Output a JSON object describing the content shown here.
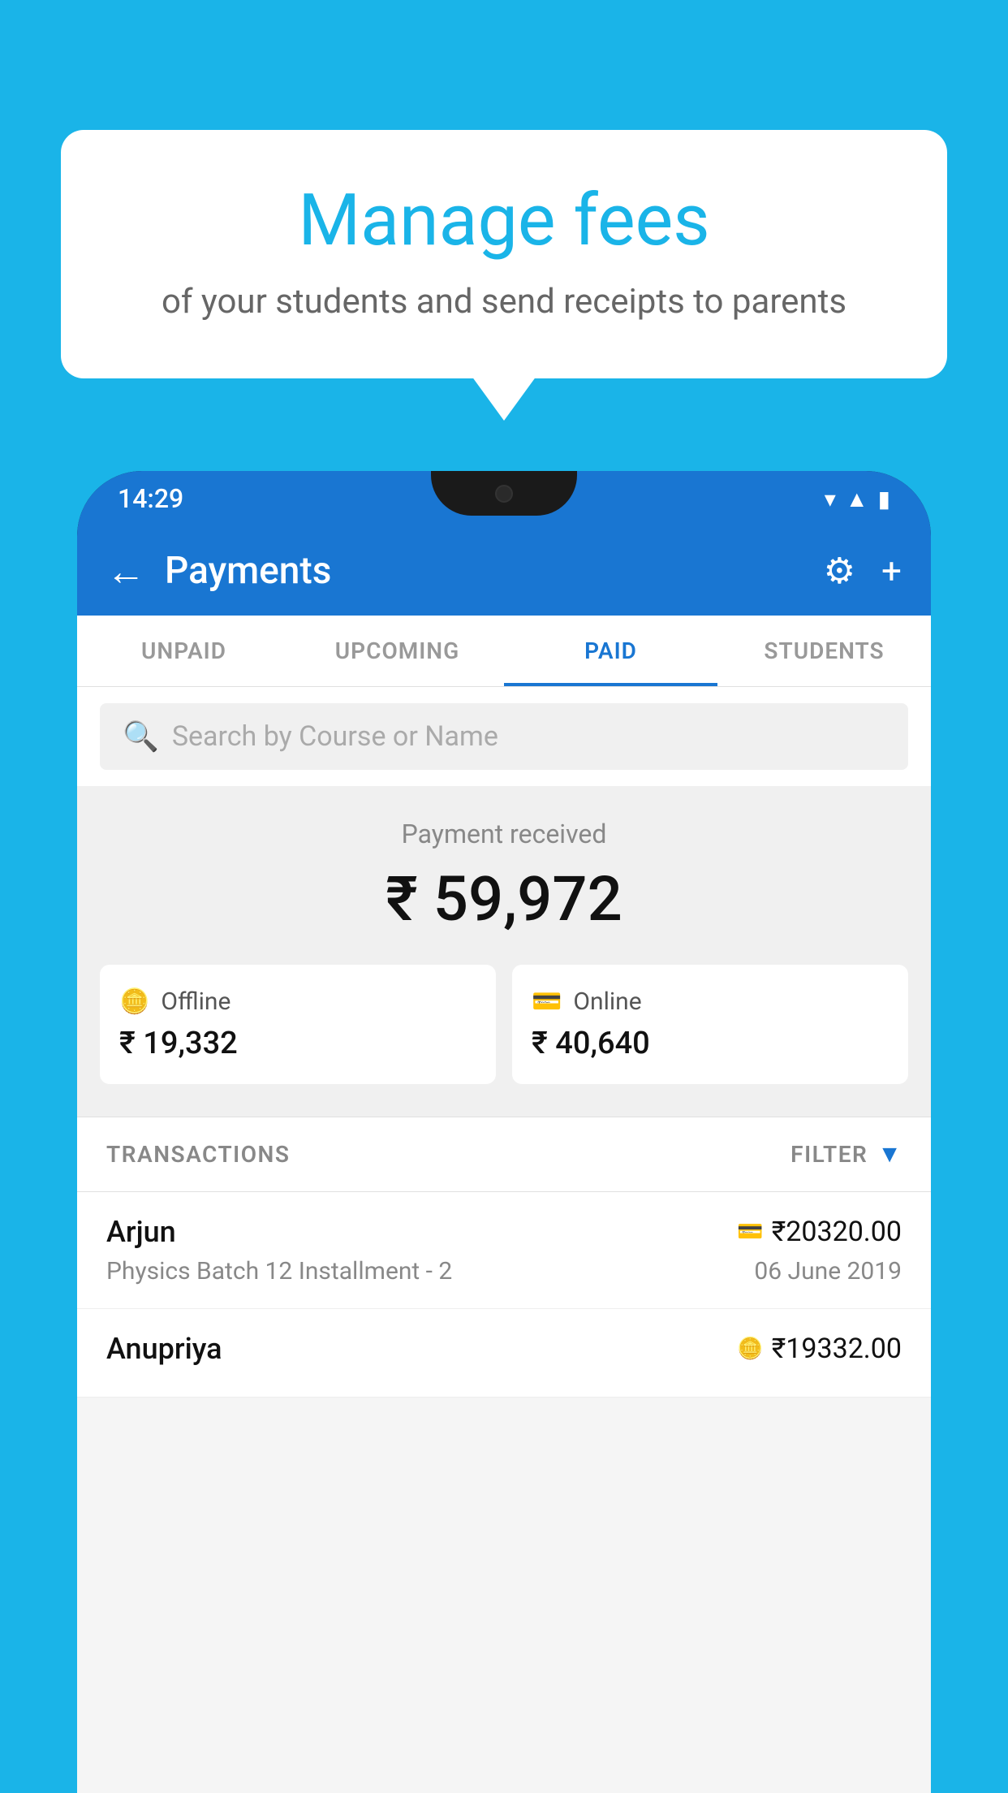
{
  "background_color": "#1ab4e8",
  "speech_bubble": {
    "title": "Manage fees",
    "subtitle": "of your students and send receipts to parents"
  },
  "status_bar": {
    "time": "14:29"
  },
  "app_bar": {
    "title": "Payments",
    "back_icon": "←",
    "settings_icon": "⚙",
    "add_icon": "+"
  },
  "tabs": [
    {
      "label": "UNPAID",
      "active": false
    },
    {
      "label": "UPCOMING",
      "active": false
    },
    {
      "label": "PAID",
      "active": true
    },
    {
      "label": "STUDENTS",
      "active": false
    }
  ],
  "search": {
    "placeholder": "Search by Course or Name"
  },
  "payment_summary": {
    "label": "Payment received",
    "amount": "₹ 59,972",
    "offline": {
      "label": "Offline",
      "amount": "₹ 19,332"
    },
    "online": {
      "label": "Online",
      "amount": "₹ 40,640"
    }
  },
  "transactions": {
    "header_label": "TRANSACTIONS",
    "filter_label": "FILTER",
    "rows": [
      {
        "name": "Arjun",
        "amount": "₹20320.00",
        "course": "Physics Batch 12 Installment - 2",
        "date": "06 June 2019",
        "icon": "card"
      },
      {
        "name": "Anupriya",
        "amount": "₹19332.00",
        "course": "",
        "date": "",
        "icon": "cash"
      }
    ]
  }
}
